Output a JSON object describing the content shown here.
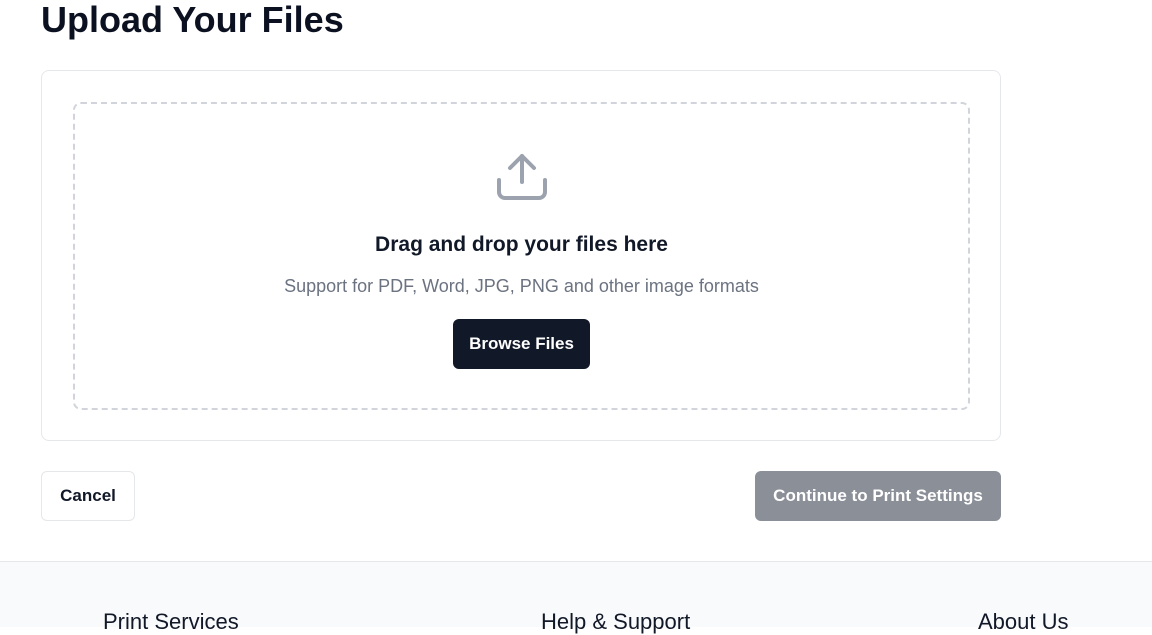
{
  "page": {
    "title": "Upload Your Files"
  },
  "upload": {
    "icon": "upload-icon",
    "drop_title": "Drag and drop your files here",
    "drop_subtitle": "Support for PDF, Word, JPG, PNG and other image formats",
    "browse_label": "Browse Files"
  },
  "actions": {
    "cancel_label": "Cancel",
    "continue_label": "Continue to Print Settings",
    "continue_disabled": true
  },
  "footer": {
    "headings": [
      "Print Services",
      "Help & Support",
      "About Us"
    ]
  },
  "colors": {
    "primary": "#111827",
    "muted_text": "#6b7280",
    "disabled_button": "#8b8f98",
    "border": "#e5e7eb",
    "dashed_border": "#d1d5db",
    "footer_bg": "#f9fafb"
  }
}
